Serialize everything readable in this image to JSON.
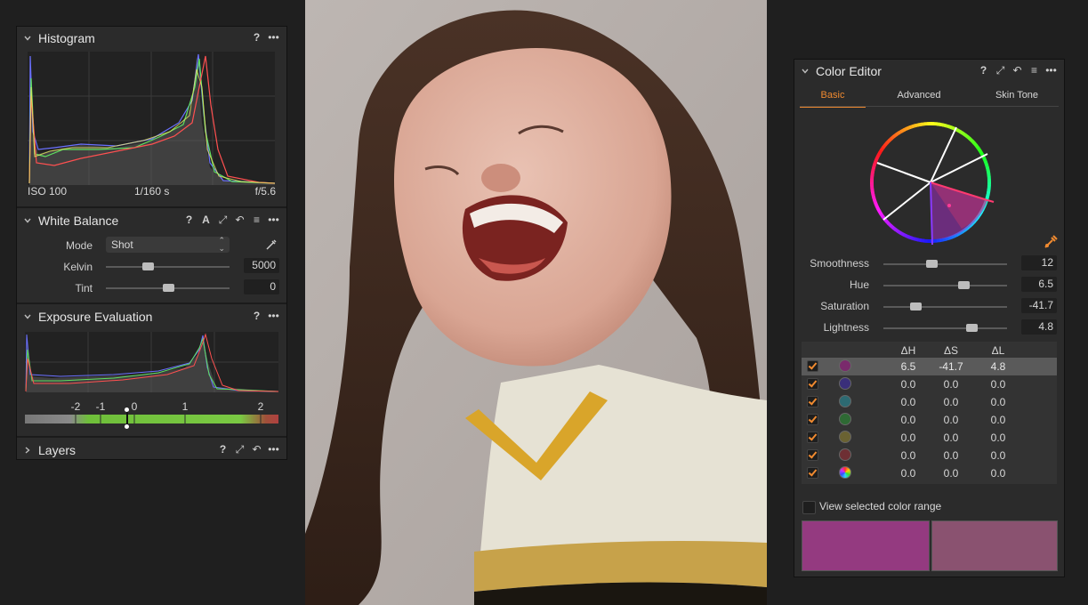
{
  "histogram": {
    "title": "Histogram",
    "iso": "ISO 100",
    "shutter": "1/160 s",
    "aperture": "f/5.6"
  },
  "white_balance": {
    "title": "White Balance",
    "mode_label": "Mode",
    "mode_value": "Shot",
    "kelvin_label": "Kelvin",
    "kelvin_value": "5000",
    "kelvin_level": 0.34,
    "tint_label": "Tint",
    "tint_value": "0",
    "tint_level": 0.5
  },
  "exposure_evaluation": {
    "title": "Exposure Evaluation",
    "scale_labels": [
      "-2",
      "-1",
      "0",
      "1",
      "2"
    ]
  },
  "layers": {
    "title": "Layers"
  },
  "color_editor": {
    "title": "Color Editor",
    "tabs": [
      "Basic",
      "Advanced",
      "Skin Tone"
    ],
    "active_tab": "Basic",
    "sliders": [
      {
        "label": "Smoothness",
        "value": "12",
        "level": 0.39
      },
      {
        "label": "Hue",
        "value": "6.5",
        "level": 0.65
      },
      {
        "label": "Saturation",
        "value": "-41.7",
        "level": 0.26
      },
      {
        "label": "Lightness",
        "value": "4.8",
        "level": 0.71
      }
    ],
    "table_headers": [
      "ΔH",
      "ΔS",
      "ΔL"
    ],
    "rows": [
      {
        "color": "#7a2a6c",
        "dh": "6.5",
        "ds": "-41.7",
        "dl": "4.8",
        "selected": true
      },
      {
        "color": "#3a2f7a",
        "dh": "0.0",
        "ds": "0.0",
        "dl": "0.0"
      },
      {
        "color": "#2d6a72",
        "dh": "0.0",
        "ds": "0.0",
        "dl": "0.0"
      },
      {
        "color": "#2e6a34",
        "dh": "0.0",
        "ds": "0.0",
        "dl": "0.0"
      },
      {
        "color": "#6a6232",
        "dh": "0.0",
        "ds": "0.0",
        "dl": "0.0"
      },
      {
        "color": "#6e2f34",
        "dh": "0.0",
        "ds": "0.0",
        "dl": "0.0"
      },
      {
        "color": "rainbow",
        "dh": "0.0",
        "ds": "0.0",
        "dl": "0.0"
      }
    ],
    "view_range_label": "View selected color range",
    "swatch_before": "#943a80",
    "swatch_after": "#8a5270"
  },
  "colors": {
    "accent": "#f08a30",
    "panel_bg": "#2b2b2b"
  }
}
